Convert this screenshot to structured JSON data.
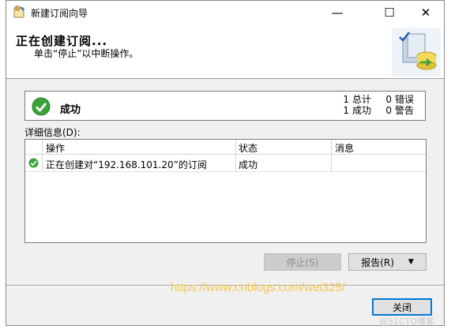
{
  "window": {
    "title": "新建订阅向导",
    "controls": {
      "minimize": "—",
      "maximize": "☐",
      "close": "✕"
    }
  },
  "header": {
    "heading": "正在创建订阅...",
    "subtitle": "单击“停止”以中断操作。"
  },
  "status": {
    "result": "成功",
    "stats": [
      {
        "count": "1",
        "label": "总计",
        "count2": "0",
        "label2": "错误"
      },
      {
        "count": "1",
        "label": "成功",
        "count2": "0",
        "label2": "警告"
      }
    ]
  },
  "details": {
    "label": "详细信息(D):",
    "columns": [
      "操作",
      "状态",
      "消息"
    ],
    "rows": [
      {
        "icon": "success-icon",
        "action": "正在创建对“192.168.101.20”的订阅",
        "status": "成功",
        "message": ""
      }
    ]
  },
  "buttons": {
    "stop": "停止(S)",
    "report": "报告(R)",
    "close": "关闭"
  },
  "watermarks": {
    "url": "https://www.cnblogs.com/wei325/",
    "blog": "@51CTO博客"
  },
  "colors": {
    "success_green": "#3aa33a",
    "default_button_border": "#0078d7",
    "watermark_yellow": "#f5c84c"
  }
}
